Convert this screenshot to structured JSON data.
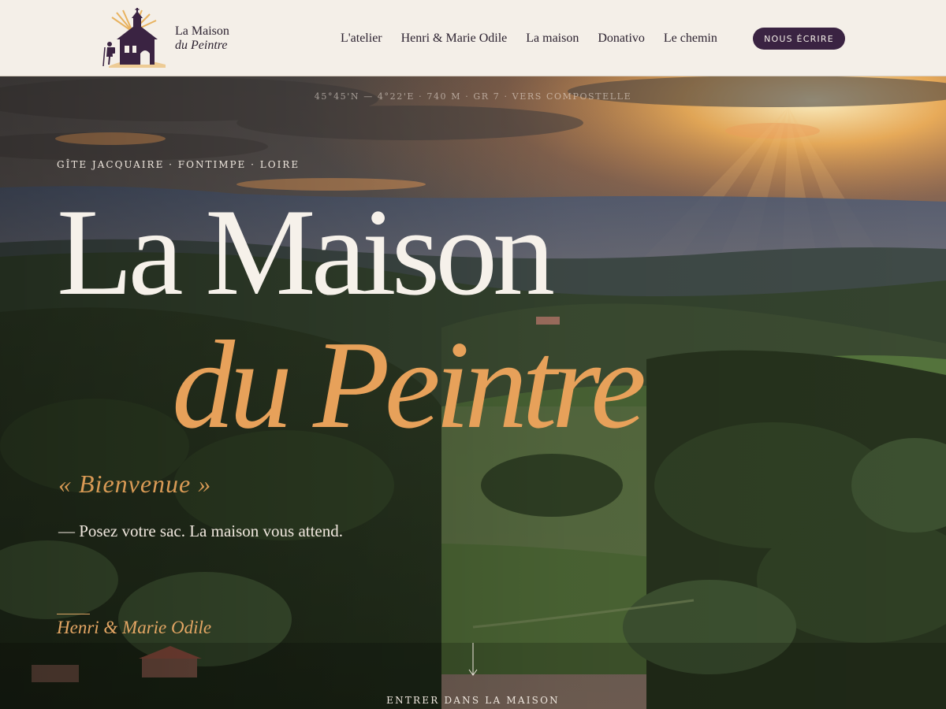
{
  "brand": {
    "line1": "La Maison",
    "line2": "du Peintre"
  },
  "nav": {
    "items": [
      "L'atelier",
      "Henri & Marie Odile",
      "La maison",
      "Donativo",
      "Le chemin"
    ],
    "cta": "NOUS ÉCRIRE"
  },
  "hero": {
    "coords": "45°45'N — 4°22'E  ·  740 M  ·  GR 7 · VERS COMPOSTELLE",
    "eyebrow": "GÎTE JACQUAIRE · FONTIMPE · LOIRE",
    "title_line1": "La Maison",
    "title_line2": "du Peintre",
    "welcome": "« Bienvenue »",
    "tagline": "— Posez votre sac. La maison vous attend.",
    "signature": "Henri & Marie Odile",
    "enter_label": "ENTRER DANS LA MAISON"
  },
  "colors": {
    "header_bg": "#f4efe8",
    "accent_plum": "#3a2342",
    "accent_gold": "#e7a15a",
    "text_dark": "#2c2230"
  },
  "icons": {
    "logo": "chapel-pilgrim-logo-icon",
    "scroll": "arrow-down-icon"
  }
}
